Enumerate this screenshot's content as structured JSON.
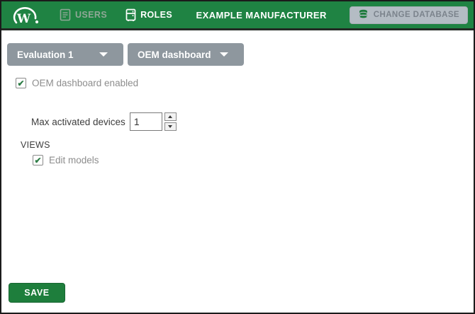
{
  "header": {
    "nav": [
      {
        "label": "USERS"
      },
      {
        "label": "ROLES"
      }
    ],
    "title": "EXAMPLE MANUFACTURER",
    "change_database_label": "CHANGE DATABASE"
  },
  "toolbar": {
    "role_select_value": "Evaluation 1",
    "section_select_value": "OEM dashboard"
  },
  "form": {
    "oem_enabled_label": "OEM dashboard enabled",
    "oem_enabled_checked": true,
    "max_devices_label": "Max activated devices",
    "max_devices_value": "1",
    "views_heading": "VIEWS",
    "edit_models_label": "Edit models",
    "edit_models_checked": true,
    "save_label": "SAVE"
  },
  "icons": {
    "check": "✔"
  },
  "colors": {
    "header_green": "#1f8343",
    "accent_green": "#1e7e3c",
    "dropdown_gray": "#8e979e",
    "change_db_button_gray": "#b4bcc4",
    "check_green": "#2e7d46",
    "muted_nav_text": "#8fa796"
  }
}
